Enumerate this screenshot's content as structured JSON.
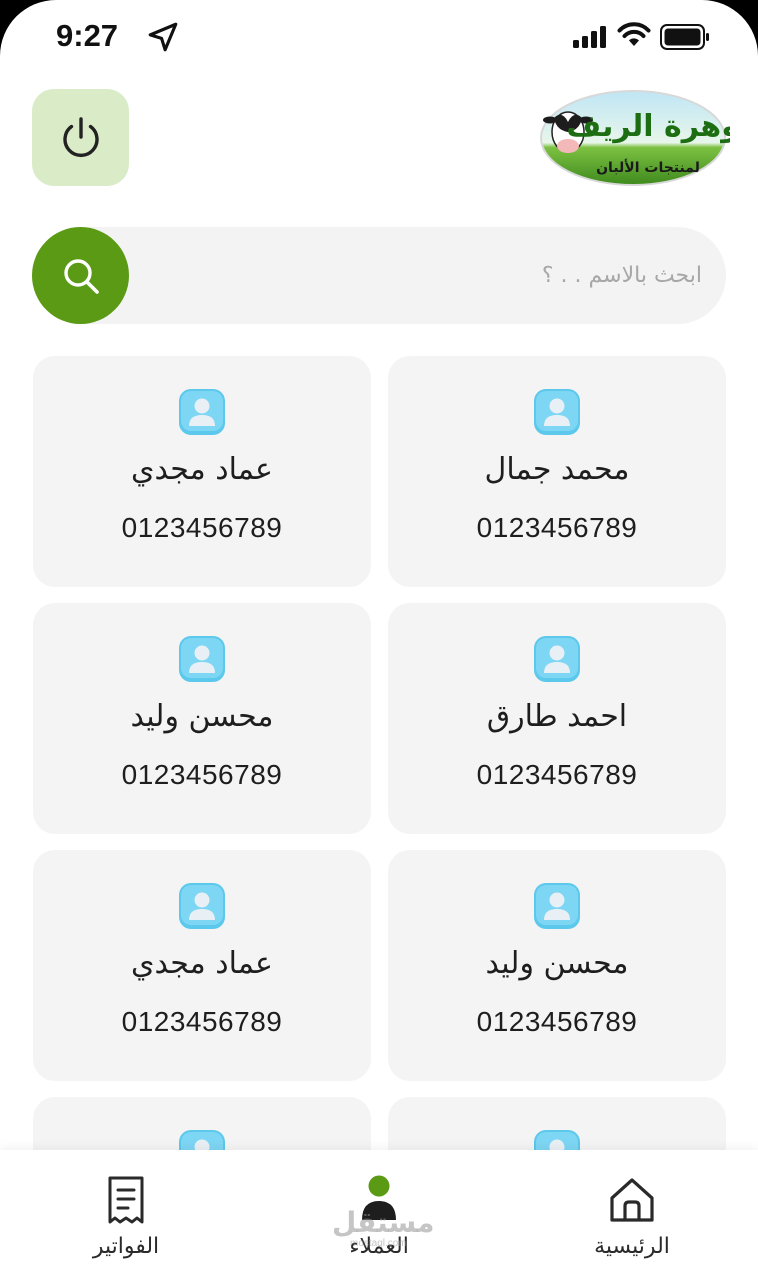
{
  "status_bar": {
    "time": "9:27",
    "icons": [
      "location-arrow-icon",
      "signal-icon",
      "wifi-icon",
      "battery-icon"
    ]
  },
  "header": {
    "power_icon": "power-icon",
    "logo": {
      "brand_name": "جوهرة الريف",
      "tagline": "لمنتجات الألبان"
    }
  },
  "search": {
    "placeholder": "ابحث بالاسم . . ؟",
    "value": "",
    "icon": "search-icon",
    "button_color": "#5b9a14"
  },
  "customers": [
    {
      "name": "محمد جمال",
      "phone": "0123456789"
    },
    {
      "name": "عماد مجدي",
      "phone": "0123456789"
    },
    {
      "name": "احمد طارق",
      "phone": "0123456789"
    },
    {
      "name": "محسن وليد",
      "phone": "0123456789"
    },
    {
      "name": "محسن وليد",
      "phone": "0123456789"
    },
    {
      "name": "عماد مجدي",
      "phone": "0123456789"
    }
  ],
  "bottom_nav": {
    "items": [
      {
        "label": "الرئيسية",
        "icon": "home-icon",
        "active": false
      },
      {
        "label": "العملاء",
        "icon": "user-icon",
        "active": true
      },
      {
        "label": "الفواتير",
        "icon": "receipt-icon",
        "active": false
      }
    ],
    "active_color": "#5b9a14"
  },
  "watermark": {
    "text": "مستقل",
    "sub": "mostaql.com"
  },
  "colors": {
    "accent": "#5b9a14",
    "power_bg": "#d9ebc7",
    "card_bg": "#f4f4f4",
    "avatar": "#5cc8ec"
  }
}
